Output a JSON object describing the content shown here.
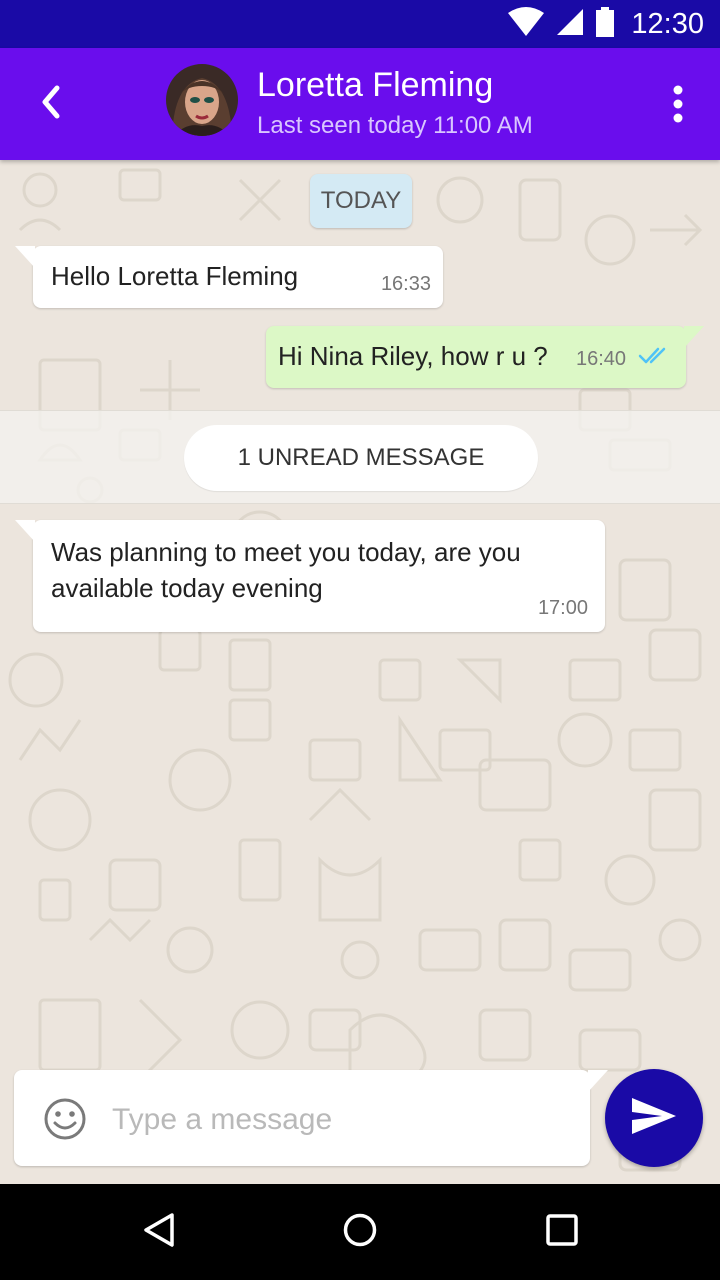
{
  "status_bar": {
    "time": "12:30",
    "icons": [
      "wifi-icon",
      "cellular-signal-icon",
      "battery-icon"
    ]
  },
  "header": {
    "contact_name": "Loretta Fleming",
    "last_seen": "Last seen today 11:00 AM",
    "icons": [
      "back-arrow-icon",
      "more-vertical-icon"
    ]
  },
  "chat": {
    "date_chip": "TODAY",
    "messages": [
      {
        "direction": "incoming",
        "text": "Hello Loretta Fleming",
        "time": "16:33"
      },
      {
        "direction": "outgoing",
        "text": "Hi Nina Riley, how r u ?",
        "time": "16:40",
        "status": "read"
      },
      {
        "direction": "incoming",
        "text": "Was planning to meet you today, are you available today evening",
        "time": "17:00"
      }
    ],
    "unread_label": "1 UNREAD MESSAGE"
  },
  "composer": {
    "placeholder": "Type a message",
    "value": "",
    "icons": [
      "emoji-icon",
      "send-icon"
    ]
  },
  "nav_bar": {
    "icons": [
      "back-triangle-icon",
      "home-circle-icon",
      "recents-square-icon"
    ]
  },
  "colors": {
    "status_bar": "#1a0aa6",
    "app_bar": "#6a0ded",
    "chat_background": "#ece5dd",
    "outgoing_bubble": "#dcf8c6",
    "incoming_bubble": "#ffffff",
    "date_chip": "#d4eaf4",
    "read_ticks": "#4fc3f7",
    "send_button": "#1a0aa6"
  }
}
